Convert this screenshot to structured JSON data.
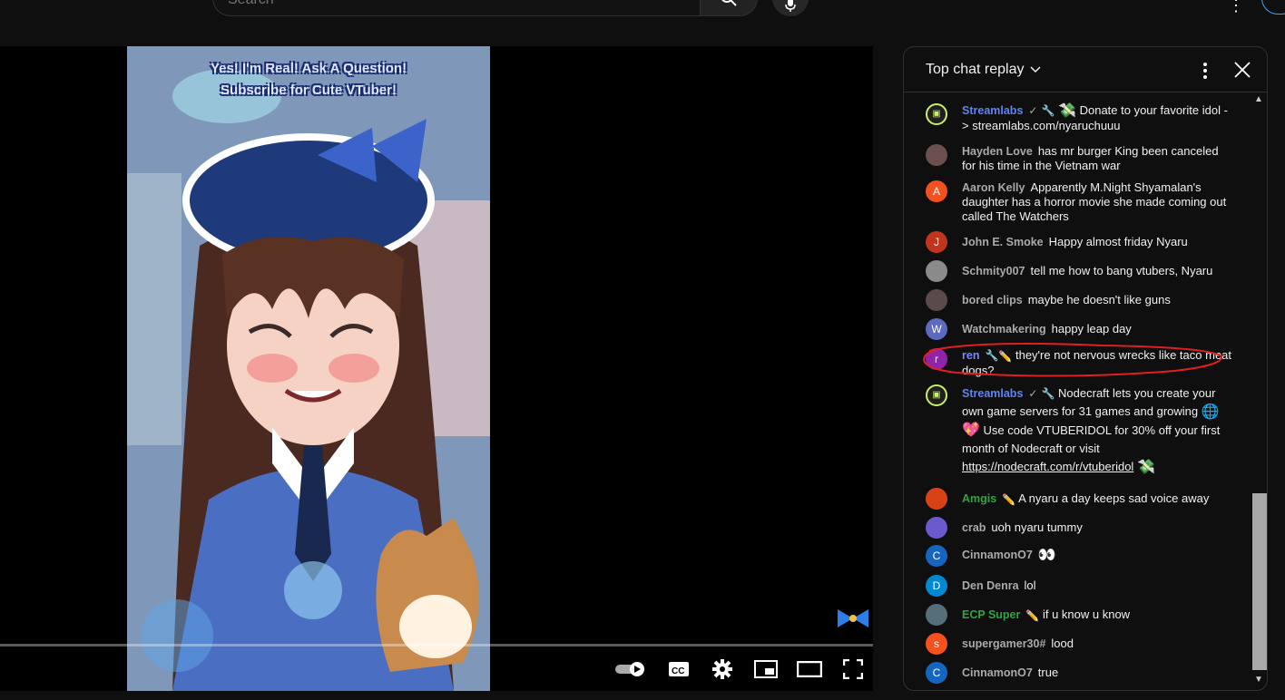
{
  "search": {
    "placeholder": "Search"
  },
  "video": {
    "caption_line1": "Yes! I'm Real! Ask A Question!",
    "caption_line2": "Subscribe for Cute VTuber!"
  },
  "chat": {
    "title": "Top chat replay",
    "messages": [
      {
        "author": "Streamlabs",
        "text_a": "Donate to your favorite idol -> streamlabs.com/nyaruchuuu",
        "avatar": "",
        "avatar_color": "#1f1f1f"
      },
      {
        "author": "Hayden Love",
        "text_a": "has mr burger King been canceled for his time in the Vietnam war",
        "avatar": "",
        "avatar_color": "#6b4f4f"
      },
      {
        "author": "Aaron Kelly",
        "text_a": "Apparently M.Night Shyamalan's daughter has a horror movie she made coming out called The Watchers",
        "avatar": "A",
        "avatar_color": "#f4511e"
      },
      {
        "author": "John E. Smoke",
        "text_a": "Happy almost friday Nyaru",
        "avatar": "J",
        "avatar_color": "#c1351d"
      },
      {
        "author": "Schmity007",
        "text_a": "tell me how to bang vtubers, Nyaru",
        "avatar": "",
        "avatar_color": "#8a8a8a"
      },
      {
        "author": "bored clips",
        "text_a": "maybe he doesn't like guns",
        "avatar": "",
        "avatar_color": "#5a4a4a"
      },
      {
        "author": "Watchmakering",
        "text_a": "happy leap day",
        "avatar": "W",
        "avatar_color": "#5c6bc0"
      },
      {
        "author": "ren",
        "text_a": "they're not nervous wrecks like taco meat dogs?",
        "avatar": "r",
        "avatar_color": "#8e24aa"
      },
      {
        "author": "Streamlabs",
        "text_a": "Nodecraft lets you create your own game servers for 31 games and growing",
        "text_b": "Use code VTUBERIDOL for 30% off your first month of Nodecraft or visit",
        "link": "https://nodecraft.com/r/vtuberidol",
        "avatar": "",
        "avatar_color": "#1f1f1f"
      },
      {
        "author": "Amgis",
        "text_a": "A nyaru a day keeps sad voice away",
        "avatar": "",
        "avatar_color": "#d84315"
      },
      {
        "author": "crab",
        "text_a": "uoh nyaru tummy",
        "avatar": "",
        "avatar_color": "#6a5acd"
      },
      {
        "author": "CinnamonO7",
        "text_a": "",
        "avatar": "C",
        "avatar_color": "#1565c0"
      },
      {
        "author": "Den Denra",
        "text_a": "lol",
        "avatar": "D",
        "avatar_color": "#0288d1"
      },
      {
        "author": "ECP Super",
        "text_a": "if u know u know",
        "avatar": "",
        "avatar_color": "#546e7a"
      },
      {
        "author": "supergamer30#",
        "text_a": "lood",
        "avatar": "s",
        "avatar_color": "#f4511e"
      },
      {
        "author": "CinnamonO7",
        "text_a": "true",
        "avatar": "C",
        "avatar_color": "#1565c0"
      }
    ]
  }
}
